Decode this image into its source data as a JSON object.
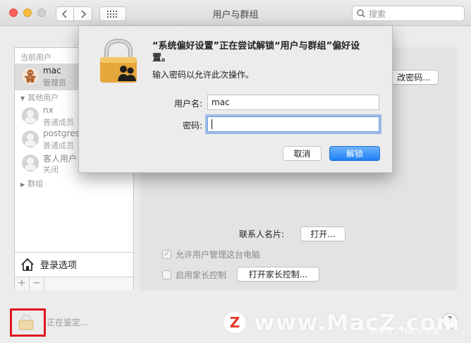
{
  "window": {
    "title": "用户与群组",
    "search_placeholder": "搜索"
  },
  "sidebar": {
    "current_users_header": "当前用户",
    "current_user": {
      "name": "mac",
      "role": "管理员"
    },
    "other_users_header": "其他用户",
    "other_users": [
      {
        "name": "nx",
        "role": "普通成员"
      },
      {
        "name": "postgres",
        "role": "普通成员"
      },
      {
        "name": "客人用户",
        "role": "关闭"
      }
    ],
    "groups_label": "群组",
    "login_options_label": "登录选项",
    "add_label": "+",
    "remove_label": "−"
  },
  "panel": {
    "change_password_label": "改密码...",
    "contact_card_label": "联系人名片:",
    "open_label": "打开...",
    "allow_admin_label": "允许用户管理这台电脑",
    "allow_admin_checked": true,
    "parental_controls_label": "启用家长控制",
    "parental_controls_checked": false,
    "open_parental_label": "打开家长控制..."
  },
  "dialog": {
    "title": "“系统偏好设置”正在尝试解锁“用户与群组”偏好设置。",
    "message": "输入密码以允许此次操作。",
    "username_label": "用户名:",
    "username_value": "mac",
    "password_label": "密码:",
    "password_value": "",
    "cancel_label": "取消",
    "unlock_label": "解锁"
  },
  "footer": {
    "auth_status": "正在鉴定...",
    "help_label": "?"
  },
  "watermark": {
    "logo_letter": "Z",
    "text": "www.MacZ.com",
    "sub": "头条号 / Mac小技能"
  },
  "colors": {
    "accent": "#1e7ff4",
    "highlight_box": "#e0141e",
    "lock_gold": "#e5a63a"
  }
}
